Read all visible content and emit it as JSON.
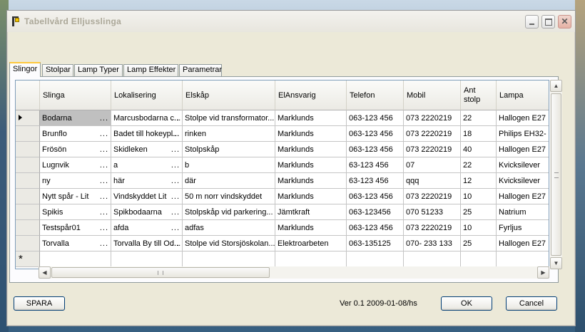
{
  "window": {
    "title": "Tabellvård Elljusslinga"
  },
  "tabs": [
    {
      "label": "Slingor",
      "active": true
    },
    {
      "label": "Stolpar",
      "active": false
    },
    {
      "label": "Lamp Typer",
      "active": false
    },
    {
      "label": "Lamp Effekter",
      "active": false
    },
    {
      "label": "Parametrar",
      "active": false
    }
  ],
  "grid": {
    "columns": [
      "Slinga",
      "Lokalisering",
      "Elskåp",
      "ElAnsvarig",
      "Telefon",
      "Mobil",
      "Ant stolp",
      "Lampa"
    ],
    "rows": [
      [
        "Bodarna",
        "Marcusbodarna c...",
        "Stolpe vid transformator...",
        "Marklunds",
        "063-123 456",
        "073 2220219",
        "22",
        "Hallogen E27"
      ],
      [
        "Brunflo",
        "Badet till hokeypl...",
        "rinken",
        "Marklunds",
        "063-123 456",
        "073 2220219",
        "18",
        "Philips EH32-"
      ],
      [
        "Frösön",
        "Skidleken",
        "Stolpskåp",
        "Marklunds",
        "063-123 456",
        "073 2220219",
        "40",
        "Hallogen E27"
      ],
      [
        "Lugnvik",
        "a",
        "b",
        "Marklunds",
        "63-123 456",
        "07",
        "22",
        "Kvicksilever"
      ],
      [
        "ny",
        "här",
        "där",
        "Marklunds",
        "63-123 456",
        "qqq",
        "12",
        "Kvicksilever"
      ],
      [
        "Nytt spår - Lit",
        "Vindskyddet Lit",
        "50 m norr vindskyddet",
        "Marklunds",
        "063-123 456",
        "073 2220219",
        "10",
        "Hallogen E27"
      ],
      [
        "Spikis",
        "Spikbodaarna",
        "Stolpskåp vid parkering...",
        "Jämtkraft",
        "063-123456",
        "070 51233",
        "25",
        "Natrium"
      ],
      [
        "Testspår01",
        "afda",
        "adfas",
        "Marklunds",
        "063-123 456",
        "073 2220219",
        "10",
        "Fyrljus"
      ],
      [
        "Torvalla",
        "Torvalla By till Od...",
        "Stolpe vid Storsjöskolan...",
        "Elektroarbeten",
        "063-135125",
        "070- 233 133",
        "25",
        "Hallogen E27"
      ]
    ],
    "selected_row": 0,
    "new_row_marker": "*",
    "current_row_marker": "▶"
  },
  "footer": {
    "save_label": "SPARA",
    "version": "Ver 0.1 2009-01-08/hs",
    "ok_label": "OK",
    "cancel_label": "Cancel"
  },
  "icons": {
    "app": "street-lamp-icon",
    "minimize": "minimize-icon",
    "maximize": "maximize-icon",
    "close": "close-icon"
  },
  "colors": {
    "tab_accent": "#ffc83c",
    "selected_cell": "#c0c0c0",
    "close_button": "#e5b1a4",
    "button_border": "#003c74"
  }
}
